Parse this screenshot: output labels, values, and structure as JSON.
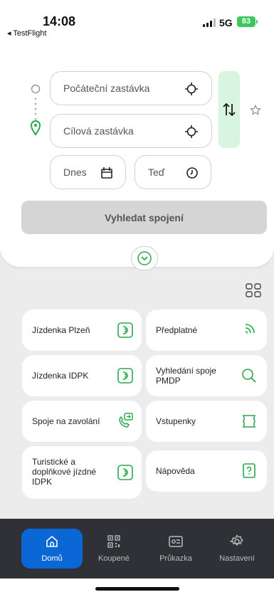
{
  "status": {
    "time": "14:08",
    "back_app": "◂ TestFlight",
    "network": "5G",
    "battery": "83"
  },
  "search": {
    "from_placeholder": "Počáteční zastávka",
    "to_placeholder": "Cílová zastávka",
    "date_label": "Dnes",
    "time_label": "Teď",
    "search_button": "Vyhledat spojení"
  },
  "tiles": [
    {
      "label": "Jízdenka Plzeň",
      "icon": "ticket-icon"
    },
    {
      "label": "Předplatné",
      "icon": "nfc-icon"
    },
    {
      "label": "Jízdenka IDPK",
      "icon": "ticket-icon"
    },
    {
      "label": "Vyhledání spoje PMDP",
      "icon": "search-icon"
    },
    {
      "label": "Spoje na zavolání",
      "icon": "phone-icon"
    },
    {
      "label": "Vstupenky",
      "icon": "voucher-icon"
    },
    {
      "label": "Turistické a doplňkové jízdné IDPK",
      "icon": "ticket-icon"
    },
    {
      "label": "Nápověda",
      "icon": "help-icon"
    }
  ],
  "nav": [
    {
      "label": "Domů",
      "icon": "home-icon"
    },
    {
      "label": "Koupené",
      "icon": "qr-icon"
    },
    {
      "label": "Průkazka",
      "icon": "card-icon"
    },
    {
      "label": "Nastavení",
      "icon": "gear-icon"
    }
  ],
  "colors": {
    "accent_green": "#2aa84a",
    "nav_active": "#0b67d6",
    "nav_bg": "#2f3136"
  }
}
